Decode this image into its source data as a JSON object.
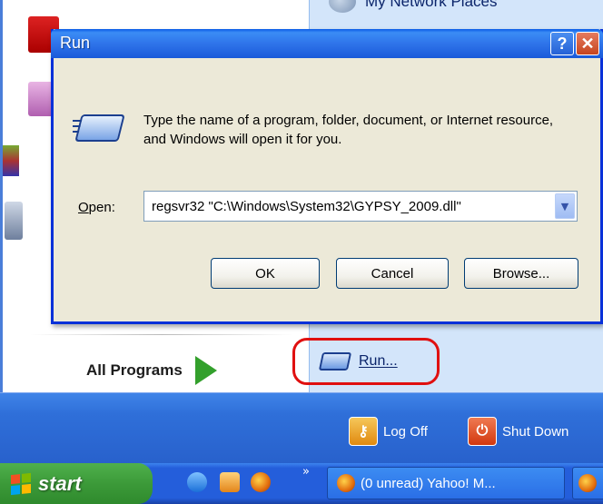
{
  "start_menu": {
    "right_top_item": "My Network Places",
    "all_programs": "All Programs",
    "run_item": "Run...",
    "log_off": "Log Off",
    "shut_down": "Shut Down"
  },
  "taskbar": {
    "start_label": "start",
    "chevron": "»",
    "task_button": "(0 unread) Yahoo! M..."
  },
  "run_dialog": {
    "title": "Run",
    "help_glyph": "?",
    "close_glyph": "✕",
    "description": "Type the name of a program, folder, document, or Internet resource, and Windows will open it for you.",
    "open_label": "Open:",
    "open_value": "regsvr32 \"C:\\Windows\\System32\\GYPSY_2009.dll\"",
    "ok_label": "OK",
    "cancel_label": "Cancel",
    "browse_label": "Browse..."
  },
  "colors": {
    "highlight_oval": "#e01010",
    "titlebar_blue": "#2f74ea",
    "start_green": "#3c9a39"
  }
}
